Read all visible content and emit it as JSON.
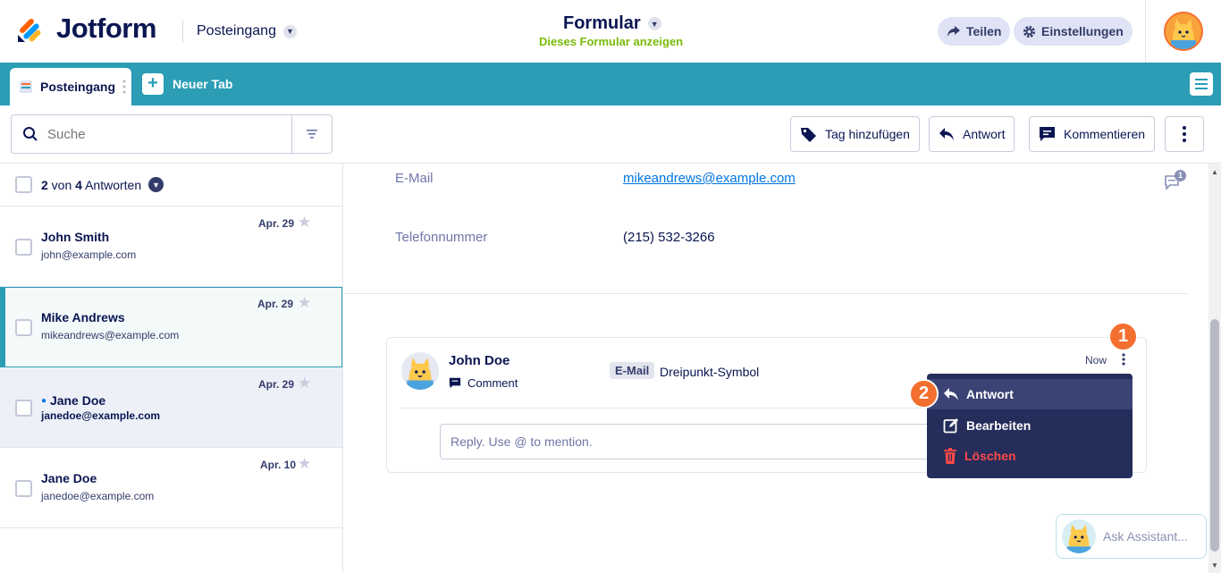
{
  "header": {
    "logo_text": "Jotform",
    "inbox_label": "Posteingang",
    "form_title": "Formular",
    "form_subtitle": "Dieses Formular anzeigen",
    "share_label": "Teilen",
    "settings_label": "Einstellungen"
  },
  "tabs": {
    "active_label": "Posteingang",
    "new_tab_label": "Neuer Tab"
  },
  "toolbar": {
    "search_placeholder": "Suche",
    "add_tag_label": "Tag hinzufügen",
    "reply_label": "Antwort",
    "comment_label": "Kommentieren"
  },
  "list": {
    "header_selected": "2",
    "header_of": " von ",
    "header_total": "4",
    "header_suffix": " Antworten",
    "items": [
      {
        "name": "John Smith",
        "email": "john@example.com",
        "date": "Apr. 29"
      },
      {
        "name": "Mike Andrews",
        "email": "mikeandrews@example.com",
        "date": "Apr. 29"
      },
      {
        "name": "Jane Doe",
        "email": "janedoe@example.com",
        "date": "Apr. 29"
      },
      {
        "name": "Jane Doe",
        "email": "janedoe@example.com",
        "date": "Apr. 10"
      }
    ]
  },
  "details": {
    "email_label": "E-Mail",
    "email_value": "mikeandrews@example.com",
    "phone_label": "Telefonnummer",
    "phone_value": "(215) 532-3266",
    "comment_count": "1"
  },
  "comment": {
    "author": "John Doe",
    "type": "Comment",
    "tag": "E-Mail",
    "text": "Dreipunkt-Symbol",
    "time": "Now",
    "reply_placeholder": "Reply. Use @ to mention."
  },
  "context_menu": {
    "reply": "Antwort",
    "edit": "Bearbeiten",
    "delete": "Löschen"
  },
  "badges": {
    "one": "1",
    "two": "2"
  },
  "assistant": {
    "label": "Ask Assistant..."
  },
  "colors": {
    "accent_teal": "#2b9db5",
    "navy": "#0a1551",
    "orange_badge": "#f36f2f",
    "menu_bg": "#252d5b",
    "delete_red": "#ff4948",
    "green_sub": "#78bb07"
  }
}
